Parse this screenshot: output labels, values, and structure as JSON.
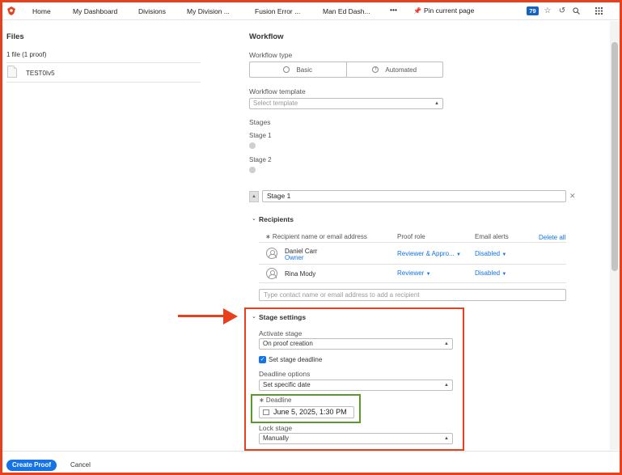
{
  "nav": {
    "items": [
      "Home",
      "My Dashboard",
      "Divisions",
      "My Division ...",
      "Fusion Error ...",
      "Man Ed Dash..."
    ],
    "more": "•••",
    "pin_label": "Pin current page",
    "badge_count": "79",
    "brand_color": "#e8401c"
  },
  "files": {
    "title": "Files",
    "count": "1 file (1 proof)",
    "file_name": "TEST0Iv5"
  },
  "workflow": {
    "title": "Workflow",
    "type_label": "Workflow type",
    "type_options": [
      "Basic",
      "Automated"
    ],
    "template_label": "Workflow template",
    "template_placeholder": "Select template",
    "stages_label": "Stages",
    "stages": [
      "Stage 1",
      "Stage 2"
    ],
    "stage_name": "Stage 1"
  },
  "recipients": {
    "title": "Recipients",
    "columns": [
      "∗ Recipient name or email address",
      "Proof role",
      "Email alerts"
    ],
    "delete_all": "Delete all",
    "rows": [
      {
        "name": "Daniel Carr",
        "sub": "Owner",
        "role": "Reviewer & Appro...",
        "alerts": "Disabled"
      },
      {
        "name": "Rina Mody",
        "sub": "",
        "role": "Reviewer",
        "alerts": "Disabled"
      }
    ],
    "add_placeholder": "Type contact name or email address to add a recipient"
  },
  "stage_settings": {
    "title": "Stage settings",
    "activate_label": "Activate stage",
    "activate_value": "On proof creation",
    "deadline_checkbox": "Set stage deadline",
    "deadline_checked": true,
    "deadline_options_label": "Deadline options",
    "deadline_options_value": "Set specific date",
    "deadline_label": "∗ Deadline",
    "deadline_value": "June 5, 2025, 1:30 PM",
    "lock_label": "Lock stage",
    "lock_value": "Manually"
  },
  "footer": {
    "create_label": "Create Proof",
    "cancel_label": "Cancel"
  },
  "colors": {
    "accent": "#1473e6",
    "annotation_red": "#e8401c",
    "annotation_green": "#5a9a2a"
  }
}
